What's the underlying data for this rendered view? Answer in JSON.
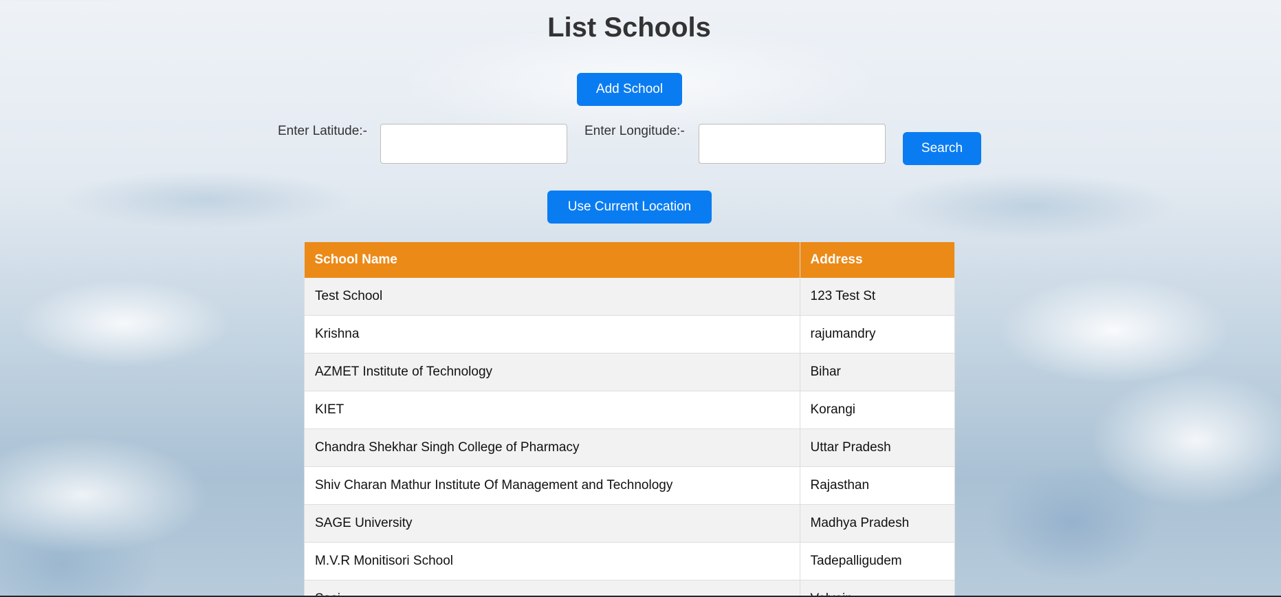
{
  "page": {
    "title": "List Schools"
  },
  "actions": {
    "add_school_label": "Add School",
    "search_label": "Search",
    "use_location_label": "Use Current Location"
  },
  "search": {
    "latitude_label": "Enter Latitude:-",
    "latitude_value": "",
    "longitude_label": "Enter Longitude:-",
    "longitude_value": ""
  },
  "table": {
    "headers": [
      "School Name",
      "Address"
    ],
    "rows": [
      {
        "name": "Test School",
        "address": "123 Test St"
      },
      {
        "name": "Krishna",
        "address": "rajumandry"
      },
      {
        "name": "AZMET Institute of Technology",
        "address": "Bihar"
      },
      {
        "name": "KIET",
        "address": "Korangi"
      },
      {
        "name": "Chandra Shekhar Singh College of Pharmacy",
        "address": "Uttar Pradesh"
      },
      {
        "name": "Shiv Charan Mathur Institute Of Management and Technology",
        "address": "Rajasthan"
      },
      {
        "name": "SAGE University",
        "address": "Madhya Pradesh"
      },
      {
        "name": "M.V.R Monitisori School",
        "address": "Tadepalligudem"
      },
      {
        "name": "Sasi",
        "address": "Velvein"
      }
    ]
  },
  "colors": {
    "primary_button": "#0a7cf2",
    "table_header": "#ec8a18",
    "row_striped": "#f2f2f2"
  }
}
